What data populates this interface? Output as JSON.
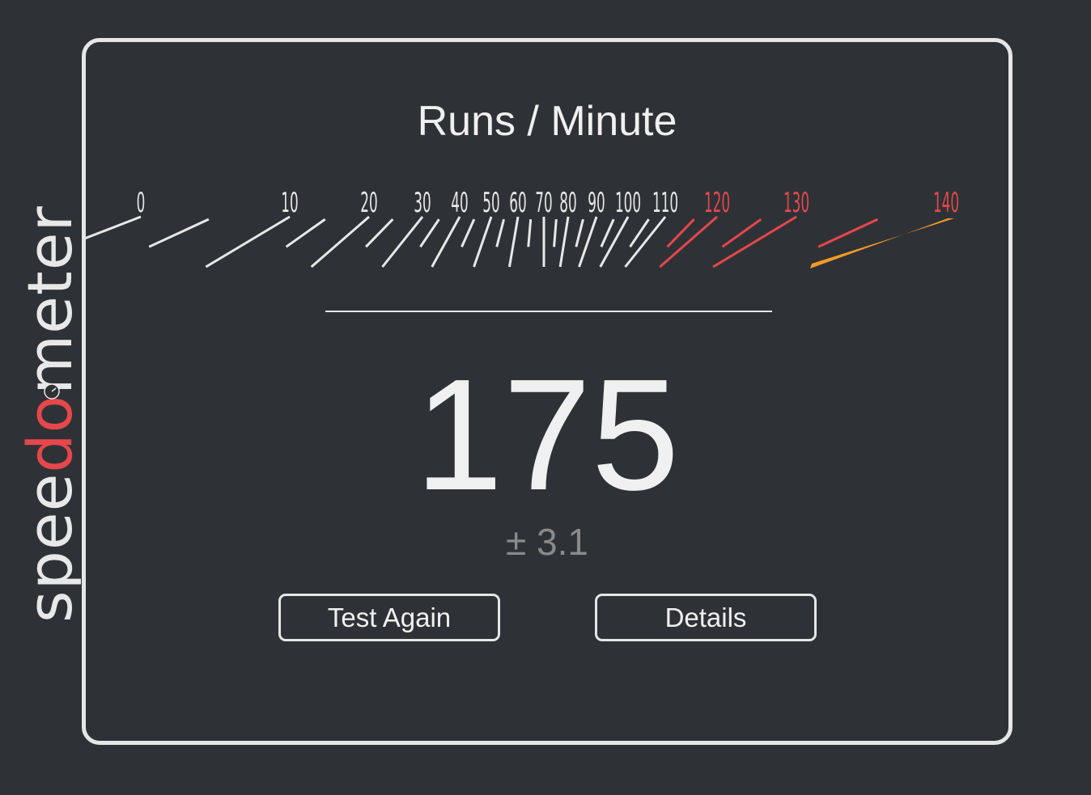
{
  "logo": {
    "text_parts": [
      "spee",
      "do",
      "meter"
    ],
    "colors": {
      "main": "#e8e8e8",
      "accent": "#e6474b"
    },
    "icon": "stopwatch-icon"
  },
  "result": {
    "title": "Runs / Minute",
    "score": "175",
    "margin": "± 3.1"
  },
  "gauge": {
    "min": 0,
    "max": 140,
    "value": 175,
    "labels": [
      "0",
      "10",
      "20",
      "30",
      "40",
      "50",
      "60",
      "70",
      "80",
      "90",
      "100",
      "110",
      "120",
      "130",
      "140"
    ],
    "red_from": 120,
    "colors": {
      "tick": "#e8e8e8",
      "red": "#e6474b",
      "needle": "#f59a23"
    }
  },
  "buttons": {
    "test_again": "Test Again",
    "details": "Details"
  }
}
